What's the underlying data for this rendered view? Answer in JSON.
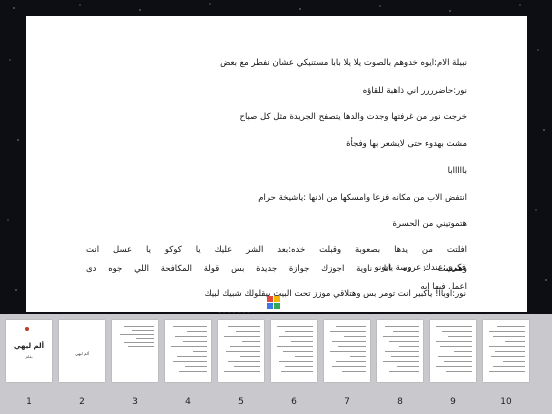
{
  "reader": {
    "lines": [
      "نبيلة الام:ايوه خدوهم بالصوت يلا يلا بابا مستنيكي عشان نفطر مع بعض",
      "نور:حاضرررر اني ذاهبة للقاؤه",
      "خرجت نور من غرفتها وجدت والدها يتصفح الجريدة مثل كل صباح",
      "مشت بهدوء حتى لايشعر بها وفجأة",
      "بااااابا",
      "انتفض الاب من مكانه فزعا وامسكها من اذنها :ياشيخة حرام",
      "هتموتيني من الحسرة",
      "افلتت من يدها بصعوبة وقبلت خده:بعد الشر عليك يا كوكو يا عسل انت",
      "وهمست : ده انا ناوية اجوزك جوازة جديدة بس قولة المكافحة اللي جوه دى",
      "اعمل فيها ايه",
      "فكري:عندك عروسة يانونو",
      "نور:اوباا! ياكبير انت تومر بس وهتلاقي موزز تحت البيت بيقلولك شبيك لبيك"
    ],
    "partial_line": "ـ ـ ـ ـ ـ ـ ـ"
  },
  "logo_colors": [
    "#e24a3b",
    "#f4b400",
    "#3b78e7",
    "#34a853"
  ],
  "thumbnails": {
    "pages": [
      "1",
      "2",
      "3",
      "4",
      "5",
      "6",
      "7",
      "8",
      "9",
      "10"
    ],
    "cover_title": "ألم ليهي",
    "cover_author": "بقلم",
    "page2_text": "ألم ليهي"
  }
}
